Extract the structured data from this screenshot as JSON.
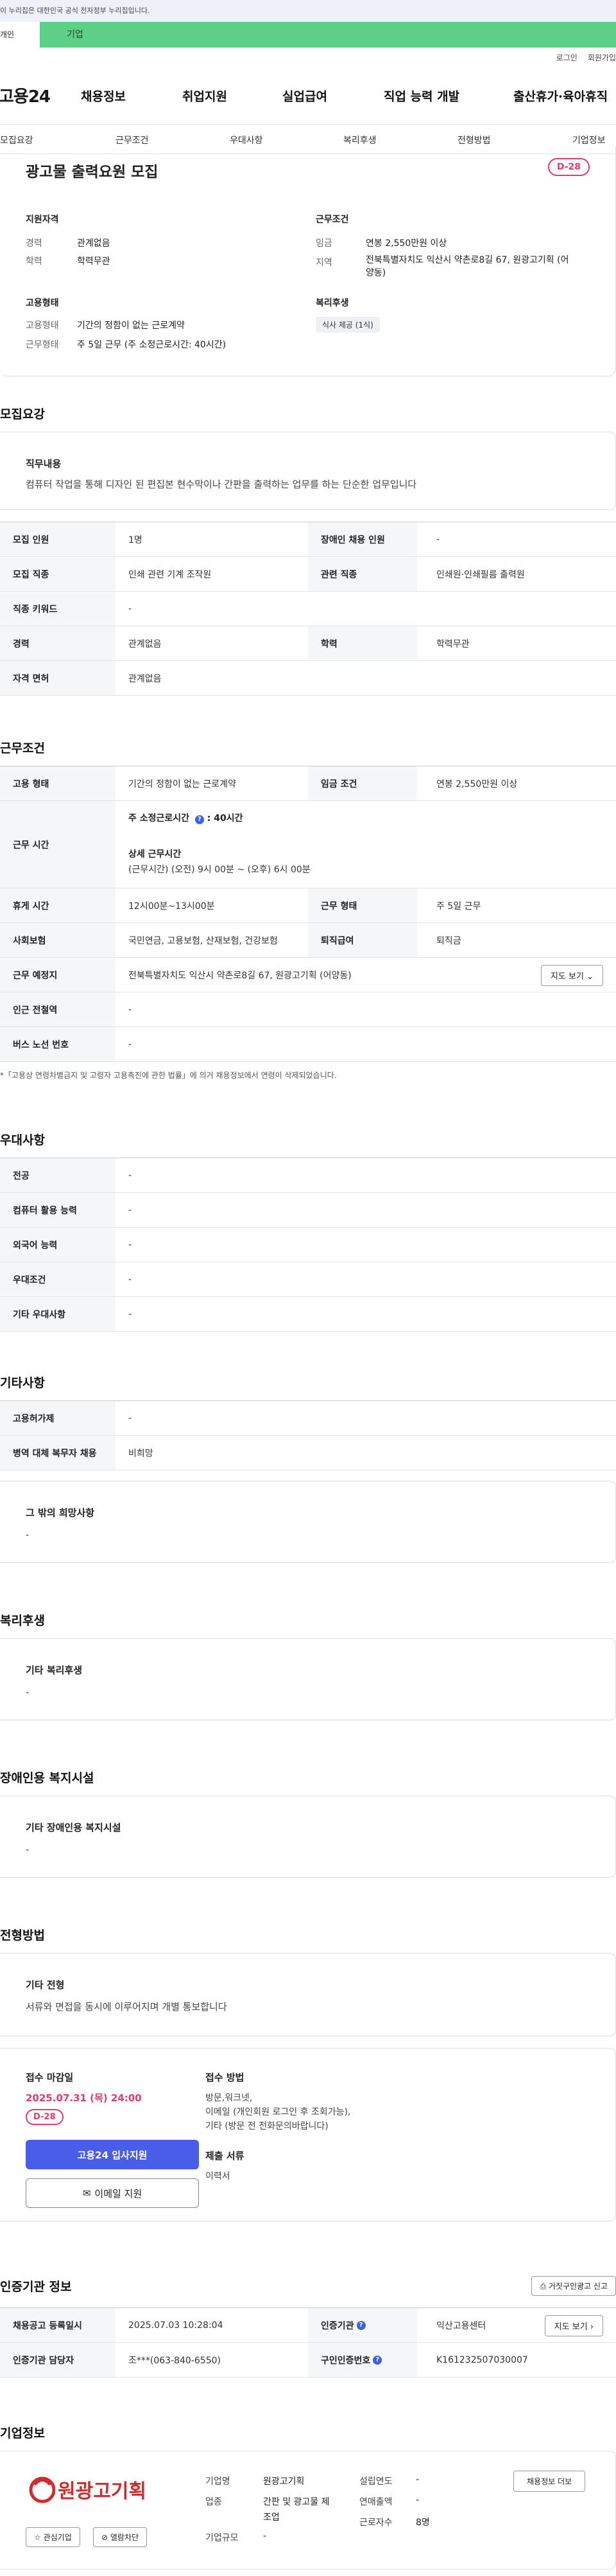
{
  "gov_banner": "이 누리집은 대한민국 공식 전자정부 누리집입니다.",
  "user_tabs": {
    "personal": "개인",
    "company": "기업"
  },
  "util_links": {
    "login": "로그인",
    "signup": "회원가입"
  },
  "logo": "고용24",
  "gnb": [
    "채용정보",
    "취업지원",
    "실업급여",
    "직업 능력 개발",
    "출산휴가·육아휴직"
  ],
  "lnb": [
    "모집요강",
    "근무조건",
    "우대사항",
    "복리후생",
    "전형방법",
    "기업정보"
  ],
  "title_card": {
    "title": "광고물 출력요원 모집",
    "dday": "D-28",
    "qualification": {
      "heading": "지원자격",
      "career_label": "경력",
      "career": "관계없음",
      "edu_label": "학력",
      "edu": "학력무관"
    },
    "conditions": {
      "heading": "근무조건",
      "wage_label": "임금",
      "wage": "연봉 2,550만원 이상",
      "region_label": "지역",
      "region_line1": "전북특별자치도 익산시 약촌로8길 67, 원광고기획 (어",
      "region_line2": "양동)"
    },
    "employment": {
      "heading": "고용형태",
      "type_label": "고용형태",
      "type": "기간의 정함이 없는 근로계약",
      "form_label": "근무형태",
      "form": "주 5일 근무 (주 소정근로시간: 40시간)"
    },
    "welfare": {
      "heading": "복리후생",
      "chip": "식사 제공 (1식)"
    }
  },
  "recruit": {
    "title": "모집요강",
    "duty_heading": "직무내용",
    "duty_text": "컴퓨터 작업을 통해 디자인 된  편집본 현수막이나 간판을 출력하는 업무를 하는 단순한 업무입니다",
    "rows": {
      "count_label": "모집 인원",
      "count": "1명",
      "disabled_label": "장애인 채용 인원",
      "disabled": "-",
      "job_label": "모집 직종",
      "job": "인쇄 관련 기계 조작원",
      "rel_label": "관련 직종",
      "rel": "인쇄원·인쇄필름 출력원",
      "kw_label": "직종 키워드",
      "kw": "-",
      "career_label": "경력",
      "career": "관계없음",
      "edu_label": "학력",
      "edu": "학력무관",
      "license_label": "자격 면허",
      "license": "관계없음"
    }
  },
  "conditions_sec": {
    "title": "근무조건",
    "emp_label": "고용 형태",
    "emp": "기간의 정함이 없는 근로계약",
    "wage_label": "임금 조건",
    "wage": "연봉 2,550만원 이상",
    "time_label": "근무 시간",
    "weekly": "주 소정근로시간",
    "weekly_val": "40시간",
    "detail_h": "상세 근무시간",
    "detail": "(근무시간) (오전) 9시 00분 ~ (오후) 6시 00분",
    "rest_label": "휴게 시간",
    "rest": "12시00분~13시00분",
    "form_label": "근무 형태",
    "form": "주 5일 근무",
    "ins_label": "사회보험",
    "ins": "국민연금, 고용보험, 산재보험, 건강보험",
    "sev_label": "퇴직급여",
    "sev": "퇴직금",
    "place_label": "근무 예정지",
    "place": "전북특별자치도 익산시 약촌로8길 67, 원광고기획 (어양동)",
    "map_btn": "지도 보기",
    "subway_label": "인근 전철역",
    "subway": "-",
    "bus_label": "버스 노선 번호",
    "bus": "-",
    "note": "*「고용상 연령차별금지 및 고령자 고용촉진에 관한 법률」에 의거 채용정보에서 연령이 삭제되었습니다."
  },
  "pref": {
    "title": "우대사항",
    "major_label": "전공",
    "major": "-",
    "pc_label": "컴퓨터 활용 능력",
    "pc": "-",
    "lang_label": "외국어 능력",
    "lang": "-",
    "cond_label": "우대조건",
    "cond": "-",
    "etc_label": "기타 우대사항",
    "etc": "-"
  },
  "etc": {
    "title": "기타사항",
    "ins_label": "고용허가제",
    "ins": "-",
    "mil_label": "병역 대체 복무자 채용",
    "mil": "비희망",
    "wish_h": "그 밖의 희망사항",
    "wish": "-"
  },
  "welfare": {
    "title": "복리후생",
    "h": "기타 복리후생",
    "v": "-"
  },
  "facility": {
    "title": "장애인용 복지시설",
    "h": "기타 장애인용 복지시설",
    "v": "-"
  },
  "process": {
    "title": "전형방법",
    "etc_h": "기타 전형",
    "etc_v": "서류와 면접을 동시에 이루어지며 개별 통보합니다",
    "deadline_h": "접수 마감일",
    "deadline": "2025.07.31 (목) 24:00",
    "dday": "D-28",
    "apply_btn": "고용24 입사지원",
    "email_btn": "이메일 지원",
    "method_h": "접수 방법",
    "method_l1": "방문,워크넷,",
    "method_l2": "이메일 (개인회원 로그인 후 조회가능),",
    "method_l3": "기타 (방문 전 전화문의바랍니다)",
    "docs_h": "제출 서류",
    "docs": "이력서"
  },
  "agency": {
    "title": "인증기관 정보",
    "report_btn": "거짓구인광고 신고",
    "reg_label": "채용공고 등록일시",
    "reg": "2025.07.03 10:28:04",
    "agency_label": "인증기관",
    "agency": "익산고용센터",
    "map_btn": "지도 보기",
    "manager_label": "인증기관 담당자",
    "manager": "조***(063-840-6550)",
    "num_label": "구인인증번호",
    "num": "K161232507030007"
  },
  "company": {
    "title": "기업정보",
    "logo_text": "원광고기획",
    "fav_btn": "관심기업",
    "block_btn": "열람차단",
    "name_label": "기업명",
    "name": "원광고기획",
    "biz_label": "업종",
    "biz_l1": "간판 및 광고물 제",
    "biz_l2": "조업",
    "scale_label": "기업규모",
    "scale": "-",
    "year_label": "설립연도",
    "year": "-",
    "sales_label": "연매출액",
    "sales": "-",
    "emp_label": "근로자수",
    "emp": "8명",
    "more_btn": "채용정보 더보"
  }
}
